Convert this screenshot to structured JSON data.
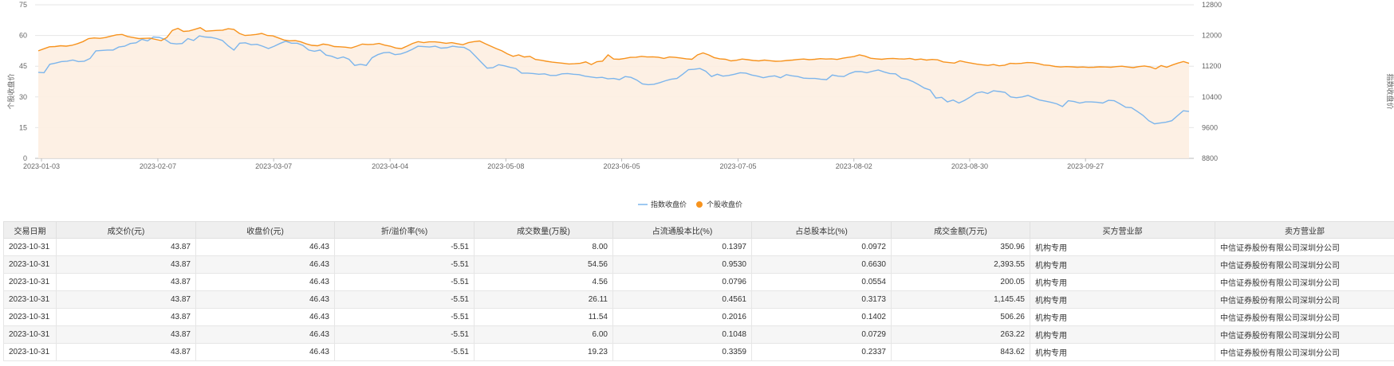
{
  "chart_data": {
    "type": "line",
    "x_labels": [
      "2023-01-03",
      "2023-02-07",
      "2023-03-07",
      "2023-04-04",
      "2023-05-08",
      "2023-06-05",
      "2023-07-05",
      "2023-08-02",
      "2023-08-30",
      "2023-09-27"
    ],
    "y_left_ticks": [
      "0",
      "15",
      "30",
      "45",
      "60",
      "75"
    ],
    "y_right_ticks": [
      "8800",
      "9600",
      "10400",
      "11200",
      "12000",
      "12800"
    ],
    "ylim_left": [
      0,
      75
    ],
    "ylim_right": [
      8800,
      12800
    ],
    "ylabel_left": "个股收盘价",
    "ylabel_right": "指数收盘价",
    "legend_position": "bottom-center",
    "series": [
      {
        "name": "指数收盘价",
        "axis": "right",
        "color": "#7cb5ec",
        "values": [
          11040,
          11030,
          11250,
          11280,
          11320,
          11330,
          11360,
          11320,
          11330,
          11400,
          11600,
          11610,
          11620,
          11620,
          11700,
          11720,
          11790,
          11810,
          11900,
          11860,
          11960,
          11950,
          11900,
          11800,
          11780,
          11790,
          11920,
          11870,
          11990,
          11960,
          11950,
          11920,
          11870,
          11730,
          11620,
          11800,
          11810,
          11760,
          11770,
          11720,
          11660,
          11720,
          11790,
          11850,
          11800,
          11800,
          11740,
          11620,
          11590,
          11620,
          11490,
          11460,
          11400,
          11440,
          11380,
          11220,
          11250,
          11220,
          11420,
          11500,
          11550,
          11560,
          11500,
          11520,
          11570,
          11640,
          11720,
          11710,
          11700,
          11720,
          11670,
          11680,
          11720,
          11700,
          11690,
          11610,
          11460,
          11300,
          11150,
          11160,
          11240,
          11210,
          11170,
          11140,
          11020,
          11020,
          11010,
          10990,
          11000,
          10960,
          10960,
          11000,
          11010,
          10990,
          10980,
          10940,
          10920,
          10900,
          10910,
          10870,
          10880,
          10850,
          10930,
          10910,
          10840,
          10740,
          10720,
          10730,
          10770,
          10820,
          10860,
          10880,
          10990,
          11110,
          11120,
          11140,
          11070,
          10930,
          10990,
          10940,
          10960,
          10990,
          11030,
          11020,
          10970,
          10940,
          10900,
          10930,
          10950,
          10900,
          10980,
          10950,
          10930,
          10890,
          10880,
          10880,
          10860,
          10850,
          10970,
          10940,
          10930,
          11010,
          11060,
          11060,
          11030,
          11070,
          11100,
          11050,
          11010,
          11000,
          10890,
          10860,
          10800,
          10720,
          10630,
          10580,
          10370,
          10390,
          10270,
          10320,
          10240,
          10310,
          10400,
          10500,
          10530,
          10490,
          10560,
          10540,
          10520,
          10400,
          10380,
          10400,
          10440,
          10380,
          10320,
          10290,
          10260,
          10220,
          10150,
          10300,
          10280,
          10240,
          10270,
          10270,
          10260,
          10240,
          10310,
          10300,
          10220,
          10130,
          10120,
          10020,
          9920,
          9780,
          9700,
          9720,
          9740,
          9780,
          9910,
          10040,
          10020
        ]
      },
      {
        "name": "个股收盘价",
        "axis": "left",
        "color": "#f7931e",
        "values": [
          52.5,
          53.5,
          54.5,
          54.6,
          55.0,
          54.8,
          55.2,
          56.0,
          57.0,
          58.5,
          58.8,
          58.6,
          59.0,
          59.7,
          60.3,
          60.5,
          59.5,
          59.0,
          58.5,
          58.6,
          58.7,
          58.1,
          57.5,
          59.0,
          62.5,
          63.5,
          62.0,
          62.2,
          63.0,
          63.8,
          62.1,
          62.3,
          62.5,
          62.6,
          63.3,
          63.0,
          61.0,
          60.0,
          60.2,
          60.5,
          61.0,
          60.0,
          59.8,
          58.8,
          57.8,
          57.4,
          57.5,
          56.9,
          55.9,
          55.2,
          55.0,
          55.8,
          55.4,
          54.6,
          54.5,
          54.3,
          53.9,
          54.8,
          55.8,
          55.6,
          55.7,
          56.1,
          55.3,
          54.8,
          53.9,
          53.6,
          54.8,
          56.1,
          57.0,
          56.5,
          56.9,
          56.9,
          56.6,
          56.2,
          56.5,
          56.0,
          55.5,
          56.5,
          57.0,
          57.3,
          56.0,
          54.8,
          53.6,
          52.5,
          51.0,
          49.8,
          50.5,
          49.5,
          49.8,
          48.3,
          47.9,
          47.4,
          47.0,
          46.7,
          46.4,
          46.1,
          46.2,
          46.4,
          47.1,
          45.8,
          47.2,
          47.5,
          50.5,
          48.5,
          48.4,
          48.8,
          49.3,
          49.4,
          49.8,
          49.5,
          49.6,
          49.4,
          48.8,
          49.5,
          49.3,
          49.0,
          48.6,
          48.4,
          50.5,
          51.5,
          50.5,
          49.2,
          48.6,
          48.4,
          47.6,
          47.9,
          48.5,
          48.2,
          47.8,
          47.6,
          48.0,
          47.7,
          47.4,
          47.5,
          47.8,
          48.0,
          48.3,
          48.5,
          48.2,
          48.4,
          48.7,
          48.5,
          48.6,
          48.3,
          48.9,
          49.3,
          49.7,
          50.5,
          49.9,
          48.9,
          48.6,
          48.4,
          48.7,
          48.8,
          48.6,
          48.5,
          48.8,
          48.2,
          48.5,
          48.0,
          48.3,
          48.1,
          47.1,
          46.8,
          46.5,
          47.6,
          47.0,
          46.5,
          46.0,
          45.7,
          45.4,
          45.8,
          45.2,
          45.5,
          46.4,
          46.3,
          46.4,
          46.8,
          46.7,
          46.3,
          45.6,
          45.4,
          44.9,
          44.6,
          44.8,
          44.7,
          44.5,
          44.6,
          44.4,
          44.5,
          44.7,
          44.6,
          44.5,
          44.8,
          45.0,
          44.6,
          44.3,
          44.8,
          45.1,
          44.7,
          43.7,
          45.3,
          44.5,
          45.6,
          46.5,
          47.3,
          46.4
        ]
      }
    ]
  },
  "table": {
    "headers": [
      "交易日期",
      "成交价(元)",
      "收盘价(元)",
      "折/溢价率(%)",
      "成交数量(万股)",
      "占流通股本比(%)",
      "占总股本比(%)",
      "成交金额(万元)",
      "买方营业部",
      "卖方营业部"
    ],
    "rows": [
      [
        "2023-10-31",
        "43.87",
        "46.43",
        "-5.51",
        "8.00",
        "0.1397",
        "0.0972",
        "350.96",
        "机构专用",
        "中信证券股份有限公司深圳分公司"
      ],
      [
        "2023-10-31",
        "43.87",
        "46.43",
        "-5.51",
        "54.56",
        "0.9530",
        "0.6630",
        "2,393.55",
        "机构专用",
        "中信证券股份有限公司深圳分公司"
      ],
      [
        "2023-10-31",
        "43.87",
        "46.43",
        "-5.51",
        "4.56",
        "0.0796",
        "0.0554",
        "200.05",
        "机构专用",
        "中信证券股份有限公司深圳分公司"
      ],
      [
        "2023-10-31",
        "43.87",
        "46.43",
        "-5.51",
        "26.11",
        "0.4561",
        "0.3173",
        "1,145.45",
        "机构专用",
        "中信证券股份有限公司深圳分公司"
      ],
      [
        "2023-10-31",
        "43.87",
        "46.43",
        "-5.51",
        "11.54",
        "0.2016",
        "0.1402",
        "506.26",
        "机构专用",
        "中信证券股份有限公司深圳分公司"
      ],
      [
        "2023-10-31",
        "43.87",
        "46.43",
        "-5.51",
        "6.00",
        "0.1048",
        "0.0729",
        "263.22",
        "机构专用",
        "中信证券股份有限公司深圳分公司"
      ],
      [
        "2023-10-31",
        "43.87",
        "46.43",
        "-5.51",
        "19.23",
        "0.3359",
        "0.2337",
        "843.62",
        "机构专用",
        "中信证券股份有限公司深圳分公司"
      ]
    ]
  }
}
